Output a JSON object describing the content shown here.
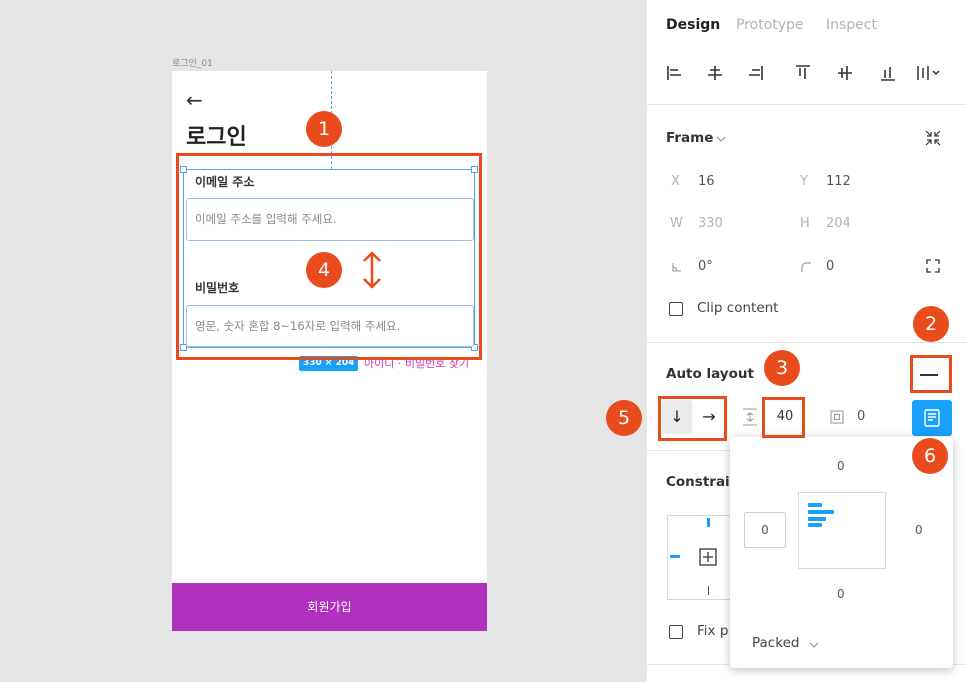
{
  "frame": {
    "name": "로그인_01",
    "back_icon": "←",
    "title": "로그인",
    "email_label": "이메일 주소",
    "email_placeholder": "이메일 주소를 입력해 주세요.",
    "password_label": "비밀번호",
    "password_placeholder": "영문, 숫자 혼합 8~16자로 입력해 주세요.",
    "size_badge": "330 × 204",
    "find_link": "아이디 · 비밀번호 찾기",
    "signup_button": "회원가입",
    "signup_color": "#b131bf"
  },
  "annotations": [
    "1",
    "2",
    "3",
    "4",
    "5",
    "6"
  ],
  "panel": {
    "tabs": [
      "Design",
      "Prototype",
      "Inspect"
    ],
    "frame_section": {
      "title": "Frame",
      "x_label": "X",
      "x": "16",
      "y_label": "Y",
      "y": "112",
      "w_label": "W",
      "w": "330",
      "h_label": "H",
      "h": "204",
      "rotation": "0°",
      "radius": "0",
      "clip_content": "Clip content"
    },
    "auto_layout": {
      "title": "Auto layout",
      "direction_down": "↓",
      "direction_right": "→",
      "spacing": "40",
      "padding": "0"
    },
    "constraints_title": "Constrai",
    "fix_label": "Fix p",
    "accent": "#18a0fb"
  },
  "popover": {
    "top": "0",
    "left": "0",
    "right": "0",
    "bottom": "0",
    "mode": "Packed"
  }
}
